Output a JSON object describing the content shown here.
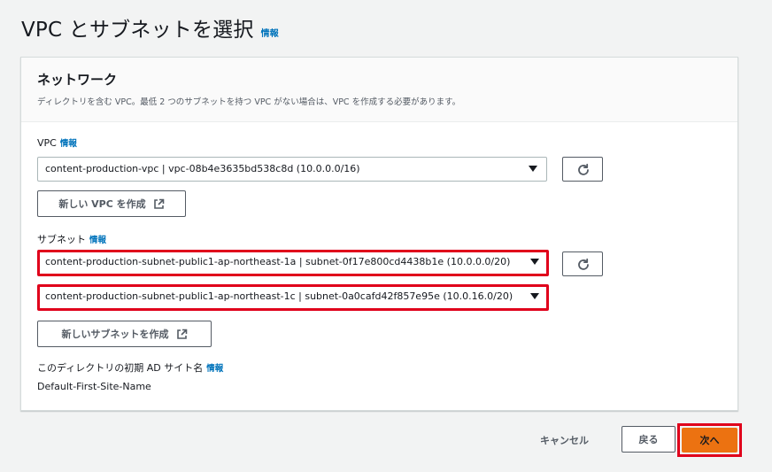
{
  "page": {
    "title": "VPC とサブネットを選択",
    "info": "情報"
  },
  "panel": {
    "title": "ネットワーク",
    "description": "ディレクトリを含む VPC。最低 2 つのサブネットを持つ VPC がない場合は、VPC を作成する必要があります。"
  },
  "vpc": {
    "label": "VPC",
    "info": "情報",
    "selected": "content-production-vpc | vpc-08b4e3635bd538c8d (10.0.0.0/16)",
    "create_label": "新しい VPC を作成"
  },
  "subnet": {
    "label": "サブネット",
    "info": "情報",
    "selected_1": "content-production-subnet-public1-ap-northeast-1a | subnet-0f17e800cd4438b1e (10.0.0.0/20)",
    "selected_2": "content-production-subnet-public1-ap-northeast-1c | subnet-0a0cafd42f857e95e (10.0.16.0/20)",
    "create_label": "新しいサブネットを作成"
  },
  "ad_site": {
    "label": "このディレクトリの初期 AD サイト名",
    "info": "情報",
    "value": "Default-First-Site-Name"
  },
  "footer": {
    "cancel": "キャンセル",
    "back": "戻る",
    "next": "次へ"
  },
  "colors": {
    "accent": "#ec7211",
    "link": "#0073bb",
    "highlight": "#e0001b"
  },
  "icons": [
    "refresh-icon",
    "external-link-icon",
    "caret-down-icon"
  ]
}
